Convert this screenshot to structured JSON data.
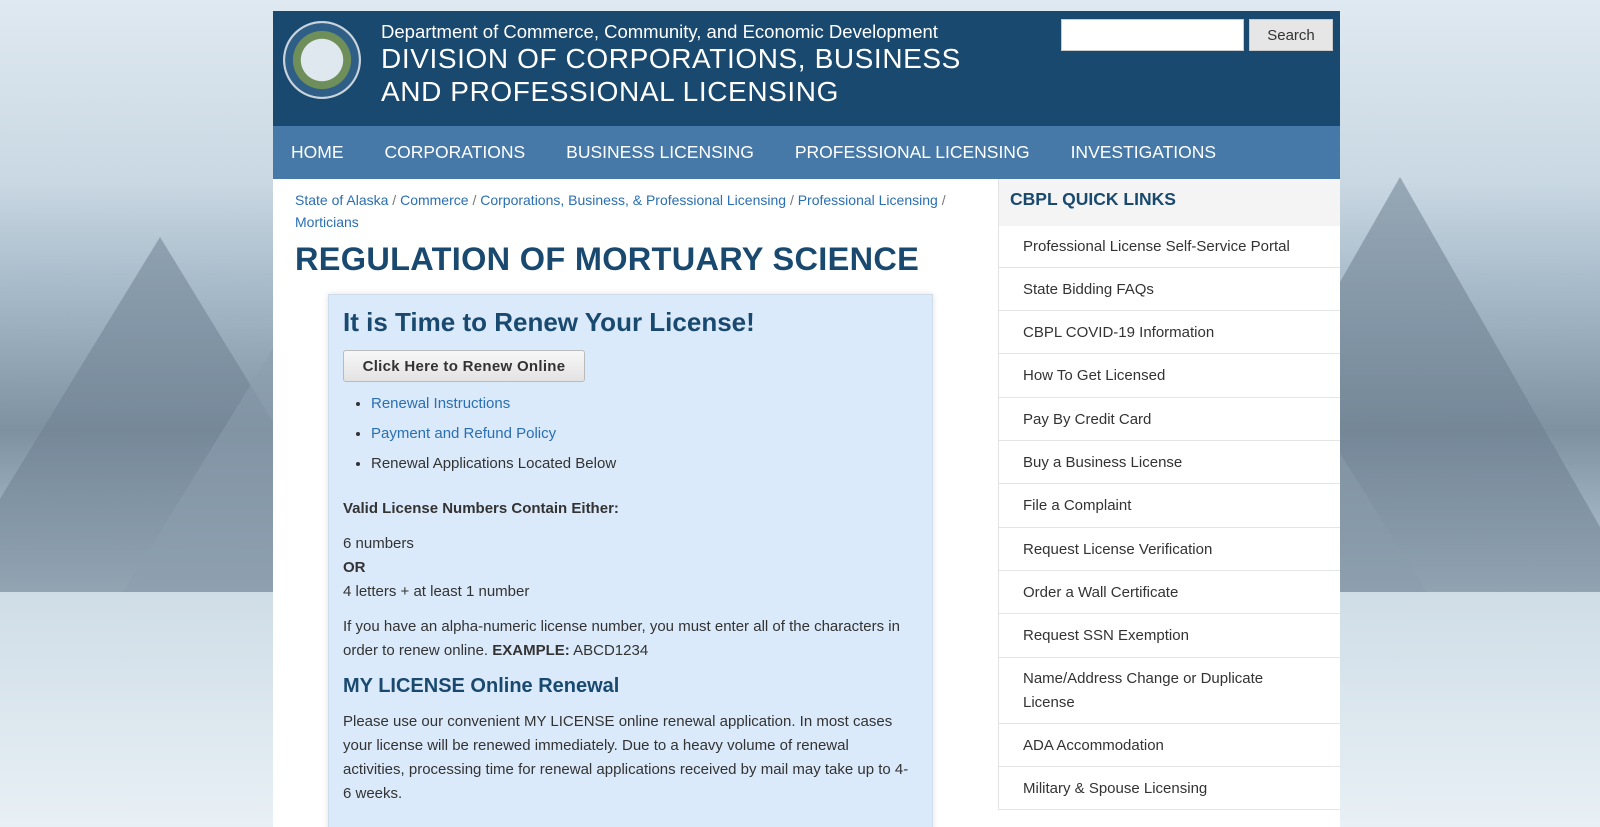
{
  "header": {
    "dept": "Department of Commerce, Community, and Economic Development",
    "division_line1": "DIVISION OF CORPORATIONS, BUSINESS",
    "division_line2": "AND PROFESSIONAL LICENSING",
    "search_label": "Search",
    "search_value": ""
  },
  "nav": {
    "items": [
      "HOME",
      "CORPORATIONS",
      "BUSINESS LICENSING",
      "PROFESSIONAL LICENSING",
      "INVESTIGATIONS"
    ]
  },
  "breadcrumb": {
    "items": [
      "State of Alaska",
      "Commerce",
      "Corporations, Business, & Professional Licensing",
      "Professional Licensing",
      "Morticians"
    ],
    "separator": "/"
  },
  "page": {
    "title": "REGULATION OF MORTUARY SCIENCE"
  },
  "renew": {
    "heading": "It is Time to Renew Your License!",
    "button": "Click Here to Renew Online",
    "list": [
      "Renewal Instructions",
      "Payment and Refund Policy",
      "Renewal Applications Located Below"
    ],
    "valid_heading": "Valid License Numbers Contain Either:",
    "option1": "6 numbers",
    "or": "OR",
    "option2": "4 letters + at least 1 number",
    "alpha_text": "If you have an alpha-numeric license number, you must enter all of the characters in order to renew online.",
    "example_label": "EXAMPLE:",
    "example_value": "ABCD1234",
    "subhead": "MY LICENSE Online Renewal",
    "mylicense_text": "Please use our convenient MY LICENSE online renewal application. In most cases your license will be renewed immediately. Due to a heavy volume of renewal activities, processing time for renewal applications received by mail may take up to 4-6 weeks."
  },
  "sidebar": {
    "title": "CBPL QUICK LINKS",
    "items": [
      "Professional License Self-Service Portal",
      "State Bidding FAQs",
      "CBPL COVID-19 Information",
      "How To Get Licensed",
      "Pay By Credit Card",
      "Buy a Business License",
      "File a Complaint",
      "Request License Verification",
      "Order a Wall Certificate",
      "Request SSN Exemption",
      "Name/Address Change or Duplicate License",
      "ADA Accommodation",
      "Military & Spouse Licensing"
    ]
  },
  "colors": {
    "header_bg": "#19496f",
    "nav_bg": "#4679a8",
    "link": "#2a6fb3",
    "renew_box_bg": "#dbeafa"
  }
}
